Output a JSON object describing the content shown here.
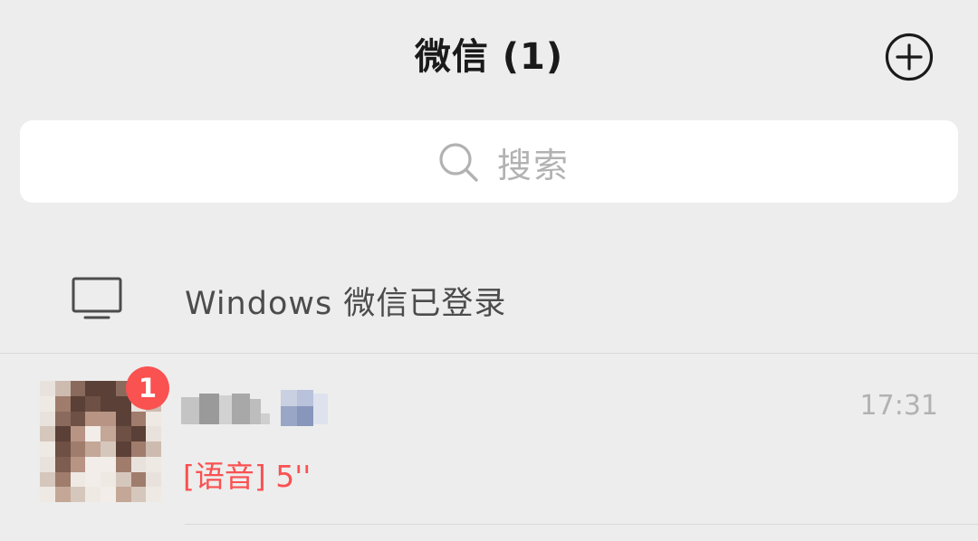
{
  "header": {
    "title": "微信 (1)",
    "add_icon": "plus-circle-icon"
  },
  "search": {
    "icon": "search-icon",
    "placeholder": "搜索"
  },
  "login_banner": {
    "icon": "monitor-icon",
    "text": "Windows 微信已登录"
  },
  "chats": [
    {
      "name": "",
      "name_obscured": true,
      "time": "17:31",
      "preview": "[语音] 5''",
      "unread": "1",
      "avatar_obscured": true
    }
  ],
  "colors": {
    "background": "#ededed",
    "search_bg": "#ffffff",
    "accent_red": "#fa5151",
    "title_text": "#1a1a1a",
    "secondary_text": "#b2b2b2",
    "divider": "#d9d9d9"
  }
}
